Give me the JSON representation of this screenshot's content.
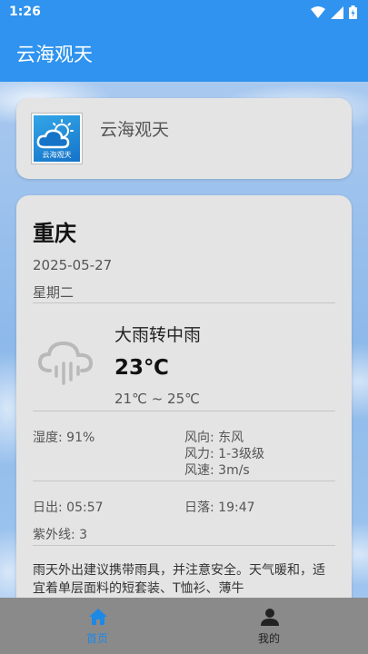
{
  "status_bar": {
    "time": "1:26"
  },
  "app_bar": {
    "title": "云海观天"
  },
  "logo_card": {
    "logo_caption": "云海观天",
    "app_name": "云海观天"
  },
  "weather": {
    "city": "重庆",
    "date": "2025-05-27",
    "weekday": "星期二",
    "icon": "rain-cloud-icon",
    "condition": "大雨转中雨",
    "temperature": "23℃",
    "temp_range": "21℃ ~ 25℃",
    "humidity": "湿度: 91%",
    "wind_direction": "风向: 东风",
    "wind_force": "风力: 1-3级级",
    "wind_speed": "风速: 3m/s",
    "sunrise": "日出: 05:57",
    "sunset": "日落: 19:47",
    "uv": "紫外线: 3",
    "advice": "雨天外出建议携带雨具，并注意安全。天气暖和，适宜着单层面料的短套装、T恤衫、薄牛"
  },
  "bottom_nav": {
    "items": [
      {
        "label": "首页",
        "icon": "home-icon",
        "active": true
      },
      {
        "label": "我的",
        "icon": "person-icon",
        "active": false
      }
    ],
    "active_color": "#1e88e5"
  },
  "colors": {
    "primary": "#2f93ef",
    "card": "#e4e4e4",
    "nav_bg": "#8a8a8a"
  }
}
